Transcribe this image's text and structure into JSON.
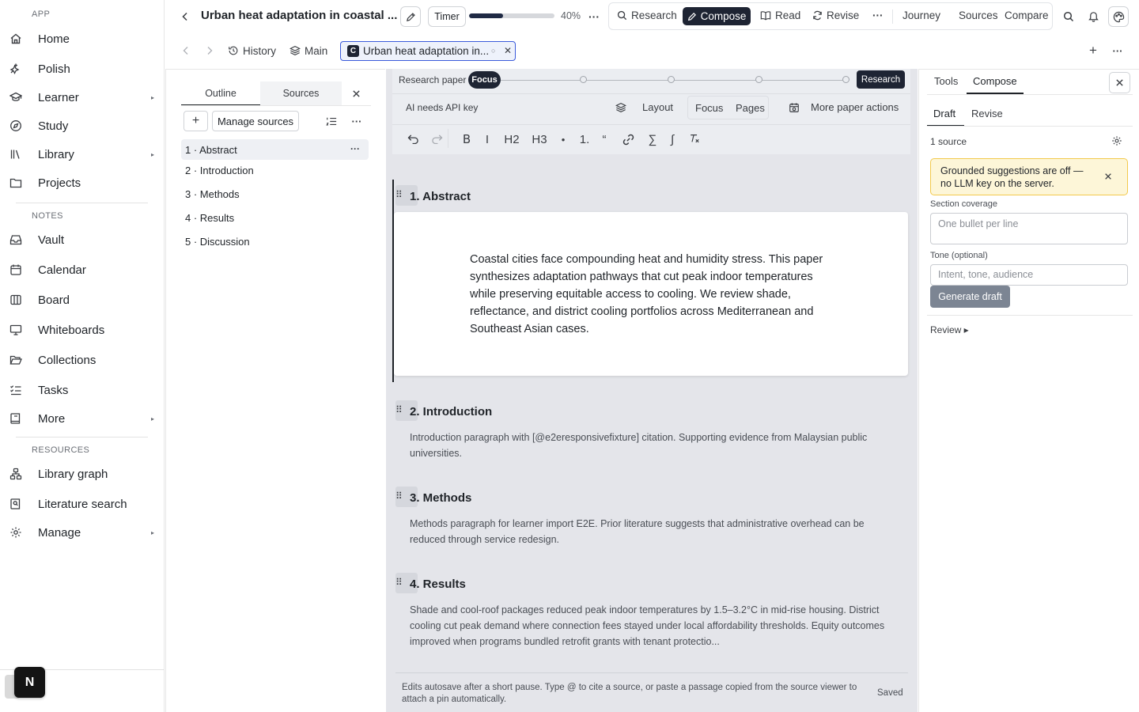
{
  "sidebar": {
    "app_label": "APP",
    "notes_label": "NOTES",
    "resources_label": "RESOURCES",
    "items": [
      {
        "label": "Home",
        "icon": "home-icon"
      },
      {
        "label": "Polish",
        "icon": "sparkles-icon"
      },
      {
        "label": "Learner",
        "icon": "graduation-cap-icon",
        "has_submenu": true
      },
      {
        "label": "Study",
        "icon": "compass-icon"
      },
      {
        "label": "Library",
        "icon": "library-icon",
        "has_submenu": true
      },
      {
        "label": "Projects",
        "icon": "folder-icon"
      },
      {
        "label": "Vault",
        "icon": "inbox-icon"
      },
      {
        "label": "Calendar",
        "icon": "calendar-icon"
      },
      {
        "label": "Board",
        "icon": "columns-icon"
      },
      {
        "label": "Whiteboards",
        "icon": "presentation-icon"
      },
      {
        "label": "Collections",
        "icon": "folder-open-icon"
      },
      {
        "label": "Tasks",
        "icon": "checklist-icon"
      },
      {
        "label": "More",
        "icon": "book-icon",
        "has_submenu": true
      },
      {
        "label": "Library graph",
        "icon": "graph-icon"
      },
      {
        "label": "Literature search",
        "icon": "book-search-icon"
      },
      {
        "label": "Manage",
        "icon": "gear-icon",
        "has_submenu": true
      }
    ],
    "badge_letter": "N"
  },
  "topbar": {
    "doc_title": "Urban heat adaptation in coastal ...",
    "timer_label": "Timer",
    "progress_percent": 40,
    "progress_label": "40%",
    "modes": {
      "research": "Research",
      "compose": "Compose",
      "read": "Read",
      "revise": "Revise",
      "journey": "Journey",
      "sources": "Sources",
      "compare": "Compare"
    }
  },
  "tabrow": {
    "history_label": "History",
    "main_label": "Main",
    "active_tab": {
      "badge": "C",
      "label": "Urban heat adaptation in..."
    }
  },
  "outline_panel": {
    "tabs": [
      "Outline",
      "Sources"
    ],
    "manage_sources_label": "Manage sources",
    "items": [
      "1 · Abstract",
      "2 · Introduction",
      "3 · Methods",
      "4 · Results",
      "5 · Discussion"
    ]
  },
  "editor": {
    "research_paper_label": "Research paper",
    "focus_pill": "Focus",
    "research_pill": "Research",
    "ai_status": "AI needs API key",
    "layout_label": "Layout",
    "focus_label": "Focus",
    "pages_label": "Pages",
    "more_actions_label": "More paper actions",
    "format_buttons": [
      "B",
      "I",
      "H2",
      "H3",
      "•",
      "1.",
      "“",
      "∑",
      "∫"
    ],
    "sections": [
      {
        "heading": "1. Abstract",
        "body": "Coastal cities face compounding heat and humidity stress. This paper synthesizes adaptation pathways that cut peak indoor temperatures while preserving equitable access to cooling. We review shade, reflectance, and district cooling portfolios across Mediterranean and Southeast Asian cases."
      },
      {
        "heading": "2. Introduction",
        "body": "Introduction paragraph with [@e2eresponsivefixture] citation. Supporting evidence from Malaysian public universities."
      },
      {
        "heading": "3. Methods",
        "body": "Methods paragraph for learner import E2E. Prior literature suggests that administrative overhead can be reduced through service redesign."
      },
      {
        "heading": "4. Results",
        "body": "Shade and cool-roof packages reduced peak indoor temperatures by 1.5–3.2°C in mid-rise housing. District cooling cut peak demand where connection fees stayed under local affordability thresholds. Equity outcomes improved when programs bundled retrofit grants with tenant protectio..."
      }
    ],
    "footer_hint": "Edits autosave after a short pause. Type @ to cite a source, or paste a passage copied from the source viewer to attach a pin automatically.",
    "save_status": "Saved"
  },
  "right_panel": {
    "tabs": [
      "Tools",
      "Compose"
    ],
    "subtabs": [
      "Draft",
      "Revise"
    ],
    "source_count": "1 source",
    "warning": "Grounded suggestions are off — no LLM key on the server.",
    "coverage_label": "Section coverage",
    "coverage_placeholder": "One bullet per line",
    "tone_label": "Tone (optional)",
    "tone_placeholder": "Intent, tone, audience",
    "generate_label": "Generate draft",
    "review_label": "Review ▸"
  },
  "colors": {
    "accent_dark": "#1e2433",
    "active_tab_border": "#3b5bdb",
    "warning_bg": "#fdf6d8",
    "warning_border": "#f2c94c",
    "editor_bg": "#e4e5ea"
  }
}
